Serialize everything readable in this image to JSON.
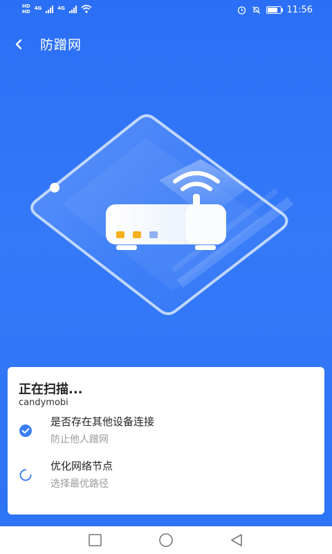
{
  "status_bar": {
    "sim1": "HD",
    "sim2": "HD",
    "net1": "4G",
    "net2": "4G",
    "time": "11:56",
    "icons": [
      "wifi-icon",
      "alarm-icon",
      "mute-icon",
      "battery-icon"
    ]
  },
  "header": {
    "title": "防蹭网",
    "back_icon": "chevron-left-icon"
  },
  "scan": {
    "title": "正在扫描...",
    "ssid": "candymobi",
    "items": [
      {
        "title": "是否存在其他设备连接",
        "subtitle": "防止他人蹭网",
        "status": "done",
        "icon": "check-circle-icon"
      },
      {
        "title": "优化网络节点",
        "subtitle": "选择最优路径",
        "status": "loading",
        "icon": "spinner-icon"
      }
    ]
  },
  "nav": {
    "recent_icon": "square-icon",
    "home_icon": "circle-icon",
    "back_icon": "triangle-back-icon"
  },
  "colors": {
    "background": "#2f74f7",
    "accent": "#3a7ef5",
    "card": "#ffffff",
    "router_led_1": "#f5b020",
    "router_led_2": "#f5b020",
    "router_led_3": "#8fb3f2"
  }
}
